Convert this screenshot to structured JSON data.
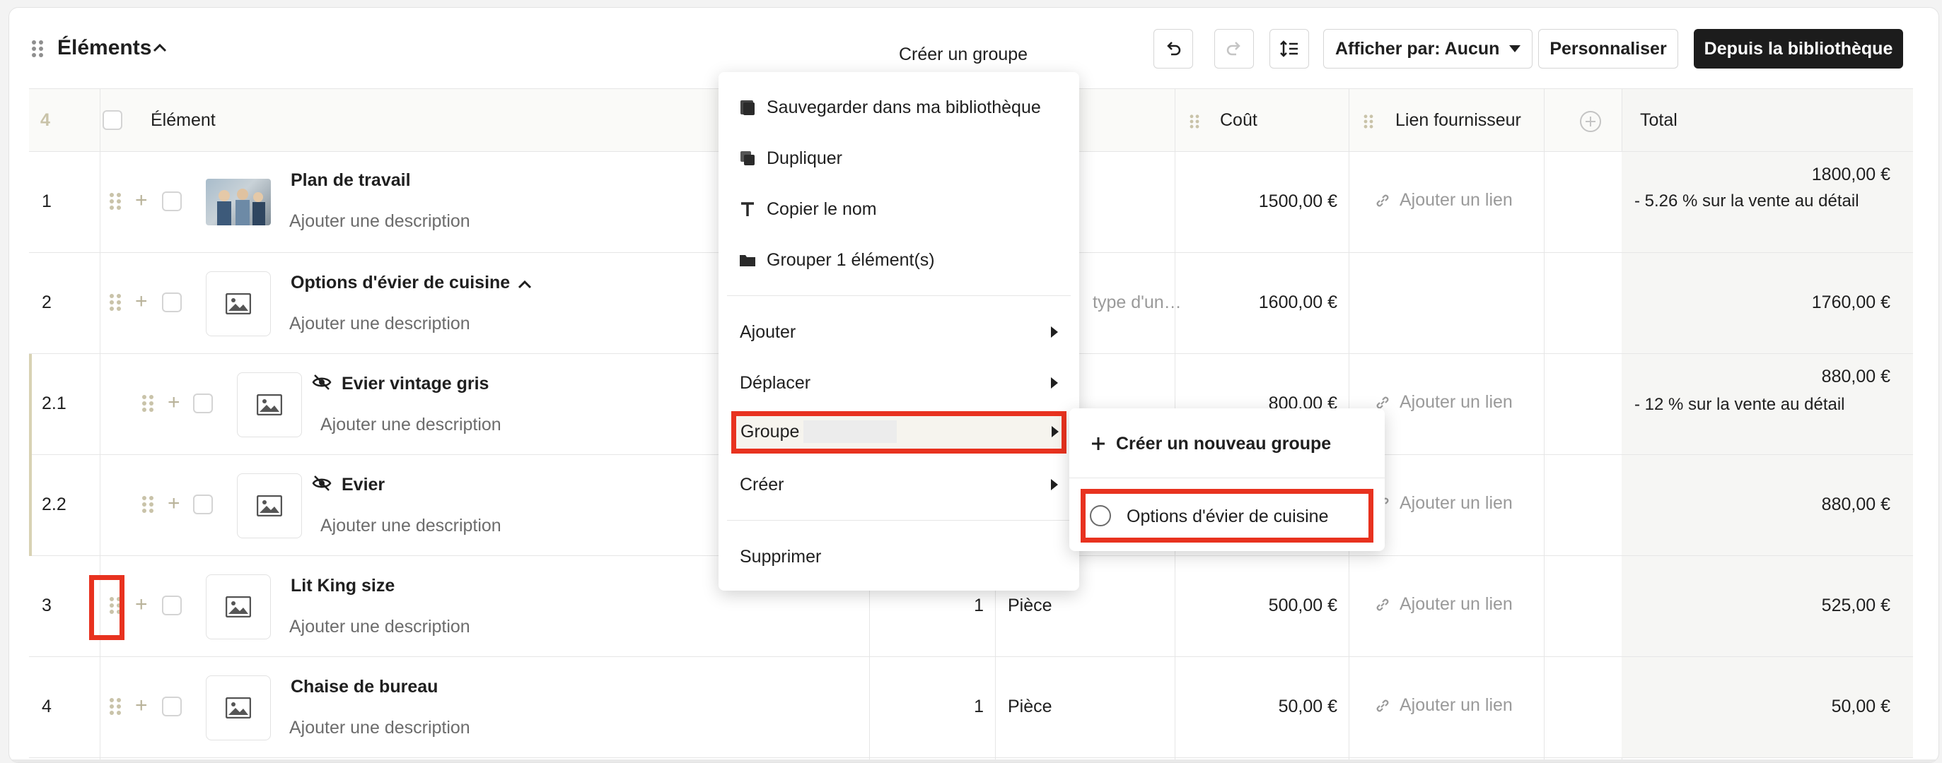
{
  "toolbar": {
    "title": "Éléments",
    "create_group": "Créer un groupe",
    "afficher_par": "Afficher par: Aucun",
    "personnaliser": "Personnaliser",
    "depuis_bibliotheque": "Depuis la bibliothèque"
  },
  "table": {
    "row_count": "4",
    "headers": {
      "element": "Élément",
      "cout": "Coût",
      "lien": "Lien fournisseur",
      "total": "Total"
    },
    "rows": [
      {
        "num": "1",
        "name": "Plan de travail",
        "desc": "Ajouter une description",
        "cout": "1500,00 €",
        "lien": "Ajouter un lien",
        "total": "1800,00 €",
        "retail": "- 5.26 % sur la vente au détail"
      },
      {
        "num": "2",
        "name": "Options d'évier de cuisine",
        "desc": "Ajouter une description",
        "type": "type d'un…",
        "cout": "1600,00 €",
        "total": "1760,00 €"
      },
      {
        "num": "2.1",
        "name": "Evier vintage gris",
        "desc": "Ajouter une description",
        "cout": "800,00 €",
        "lien": "Ajouter un lien",
        "total": "880,00 €",
        "retail": "- 12 % sur la vente au détail"
      },
      {
        "num": "2.2",
        "name": "Evier",
        "desc": "Ajouter une description",
        "lien": "Ajouter un lien",
        "total": "880,00 €"
      },
      {
        "num": "3",
        "name": "Lit King size",
        "desc": "Ajouter une description",
        "qty": "1",
        "unit": "Pièce",
        "cout": "500,00 €",
        "lien": "Ajouter un lien",
        "total": "525,00 €"
      },
      {
        "num": "4",
        "name": "Chaise de bureau",
        "desc": "Ajouter une description",
        "qty": "1",
        "unit": "Pièce",
        "cout": "50,00 €",
        "lien": "Ajouter un lien",
        "total": "50,00 €"
      }
    ]
  },
  "context_menu": {
    "save_library": "Sauvegarder dans ma bibliothèque",
    "duplicate": "Dupliquer",
    "copy_name": "Copier le nom",
    "group_items": "Grouper 1 élément(s)",
    "add": "Ajouter",
    "move": "Déplacer",
    "group": "Groupe",
    "create": "Créer",
    "delete": "Supprimer"
  },
  "submenu": {
    "new_group": "Créer un nouveau groupe",
    "option": "Options d'évier de cuisine"
  },
  "colors": {
    "highlight": "#e8321f",
    "dark_button": "#1c1c1c",
    "grip": "#c9c3a9"
  }
}
